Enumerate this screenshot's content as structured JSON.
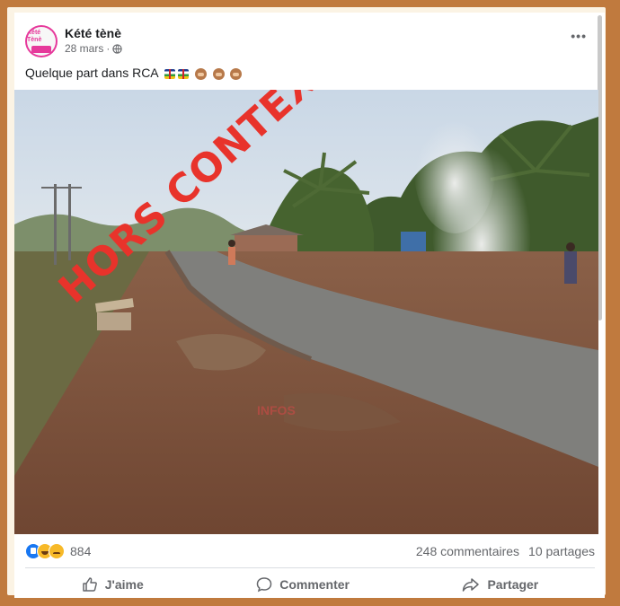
{
  "post": {
    "author": "Kété tènè",
    "avatar_text": "Kété Tènè",
    "date": "28 mars",
    "separator": "·",
    "text": "Quelque part dans RCA",
    "more_label": "•••"
  },
  "photo": {
    "overlay_text": "HORS CONTEXTE",
    "watermark_text": "INFOS"
  },
  "stats": {
    "reaction_count": "884",
    "comments": "248 commentaires",
    "shares": "10 partages"
  },
  "actions": {
    "like": "J'aime",
    "comment": "Commenter",
    "share": "Partager"
  },
  "icons": [
    "globe-icon",
    "more-icon",
    "like-reaction-icon",
    "haha-reaction-icon",
    "sad-reaction-icon",
    "thumb-up-icon",
    "comment-icon",
    "share-icon"
  ],
  "colors": {
    "frame": "#c07a3e",
    "stamp": "#e8332b",
    "brand": "#1877f2"
  }
}
